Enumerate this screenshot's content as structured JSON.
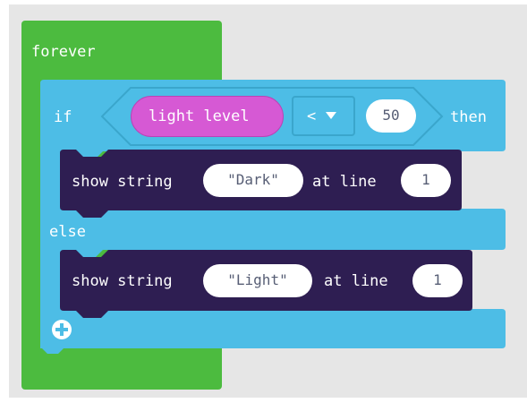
{
  "blocks": {
    "forever": {
      "label": "forever",
      "color": "#4cbb3f"
    },
    "if_block": {
      "if_label": "if",
      "then_label": "then",
      "else_label": "else",
      "color": "#4dbde6",
      "condition": {
        "left": {
          "label": "light level",
          "color": "#d659d4"
        },
        "operator": "<",
        "right": "50"
      }
    },
    "show_string_dark": {
      "label": "show string",
      "open_quote": "\"",
      "text": "Dark",
      "close_quote": "\"",
      "at_line_label": "at line",
      "line": "1",
      "color": "#2e1e52"
    },
    "show_string_light": {
      "label": "show string",
      "open_quote": "\"",
      "text": "Light",
      "close_quote": "\"",
      "at_line_label": "at line",
      "line": "1",
      "color": "#2e1e52"
    },
    "add_icon": "plus-circle-icon"
  }
}
